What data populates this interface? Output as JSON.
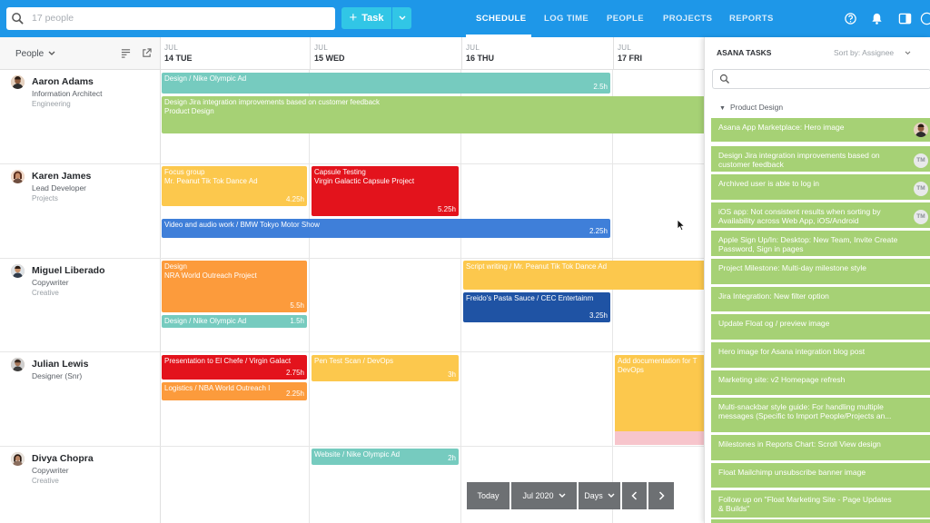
{
  "topbar": {
    "search_placeholder": "17 people",
    "task_button": "Task",
    "nav": [
      "SCHEDULE",
      "LOG TIME",
      "PEOPLE",
      "PROJECTS",
      "REPORTS"
    ],
    "active_nav": "SCHEDULE",
    "icons": [
      "help-icon",
      "bell-icon",
      "panel-toggle-icon",
      "user-menu-icon"
    ]
  },
  "people_header": {
    "label": "People"
  },
  "days": [
    {
      "month": "JUL",
      "day": "14 TUE"
    },
    {
      "month": "JUL",
      "day": "15 WED"
    },
    {
      "month": "JUL",
      "day": "16 THU"
    },
    {
      "month": "JUL",
      "day": "17 FRI"
    }
  ],
  "people": [
    {
      "name": "Aaron Adams",
      "role": "Information Architect",
      "dept": "Engineering"
    },
    {
      "name": "Karen James",
      "role": "Lead Developer",
      "dept": "Projects"
    },
    {
      "name": "Miguel Liberado",
      "role": "Copywriter",
      "dept": "Creative"
    },
    {
      "name": "Julian Lewis",
      "role": "Designer (Snr)",
      "dept": ""
    },
    {
      "name": "Divya Chopra",
      "role": "Copywriter",
      "dept": "Creative"
    }
  ],
  "tasks": [
    {
      "line1": "Design / Nike Olympic Ad",
      "line2": "",
      "hours": "2.5h",
      "color": "#76cbbf"
    },
    {
      "line1": "Design Jira integration improvements based on customer feedback",
      "line2": "Product Design",
      "hours": "",
      "color": "#a6d175"
    },
    {
      "line1": "Focus group",
      "line2": "Mr. Peanut Tik Tok Dance Ad",
      "hours": "4.25h",
      "color": "#fcc84d"
    },
    {
      "line1": "Capsule Testing",
      "line2": "Virgin Galactic Capsule Project",
      "hours": "5.25h",
      "color": "#e3131c"
    },
    {
      "line1": "Video and audio work / BMW Tokyo Motor Show",
      "line2": "",
      "hours": "2.25h",
      "color": "#3f7fd9"
    },
    {
      "line1": "Design",
      "line2": "NRA World Outreach Project",
      "hours": "5.5h",
      "color": "#fc9b3c"
    },
    {
      "line1": "Design / Nike Olympic Ad",
      "line2": "",
      "hours": "1.5h",
      "color": "#76cbbf"
    },
    {
      "line1": "Script writing / Mr. Peanut Tik Tok Dance Ad",
      "line2": "",
      "hours": "",
      "color": "#fcc84d"
    },
    {
      "line1": "Freido's Pasta Sauce / CEC Entertainm",
      "line2": "",
      "hours": "3.25h",
      "color": "#1f53a4"
    },
    {
      "line1": "Presentation to El Chefe / Virgin Galact",
      "line2": "",
      "hours": "2.75h",
      "color": "#e3131c"
    },
    {
      "line1": "Logistics / NBA World Outreach I",
      "line2": "",
      "hours": "2.25h",
      "color": "#fc9b3c"
    },
    {
      "line1": "Pen Test Scan / DevOps",
      "line2": "",
      "hours": "3h",
      "color": "#fcc84d"
    },
    {
      "line1": "Add documentation for T",
      "line2": "DevOps",
      "hours": "",
      "color": "#fcc84d"
    },
    {
      "line1": "Website / Nike Olympic Ad",
      "line2": "",
      "hours": "2h",
      "color": "#76cbbf"
    }
  ],
  "panel": {
    "title": "ASANA TASKS",
    "sort": "Sort by: Assignee",
    "group": "Product Design",
    "items": [
      {
        "text": "Asana App Marketplace: Hero image",
        "badge": "avatar"
      },
      {
        "text": "Design Jira integration improvements based on customer feedback",
        "badge": "TM"
      },
      {
        "text": "Archived user is able to log in",
        "badge": "TM"
      },
      {
        "text": "iOS app: Not consistent results when sorting by Availability across Web App, iOS/Android",
        "badge": "TM"
      },
      {
        "text": "Apple Sign Up/In: Desktop: New Team, Invite Create Password, Sign in pages",
        "badge": ""
      },
      {
        "text": "Project Milestone: Multi-day milestone style",
        "badge": ""
      },
      {
        "text": "Jira Integration: New filter option",
        "badge": ""
      },
      {
        "text": "Update Float og / preview image",
        "badge": ""
      },
      {
        "text": "Hero image for Asana integration blog post",
        "badge": ""
      },
      {
        "text": "Marketing site: v2 Homepage refresh",
        "badge": ""
      },
      {
        "text": "Multi-snackbar style guide: For handling multiple messages (Specific to Import People/Projects an...",
        "badge": ""
      },
      {
        "text": "Milestones in Reports Chart: Scroll View design",
        "badge": ""
      },
      {
        "text": "Float Mailchimp unsubscribe banner image",
        "badge": ""
      },
      {
        "text": "Follow up on \"Float Marketing Site - Page Updates & Builds\"",
        "badge": ""
      }
    ]
  },
  "bottombar": {
    "today": "Today",
    "month": "Jul 2020",
    "view": "Days"
  }
}
